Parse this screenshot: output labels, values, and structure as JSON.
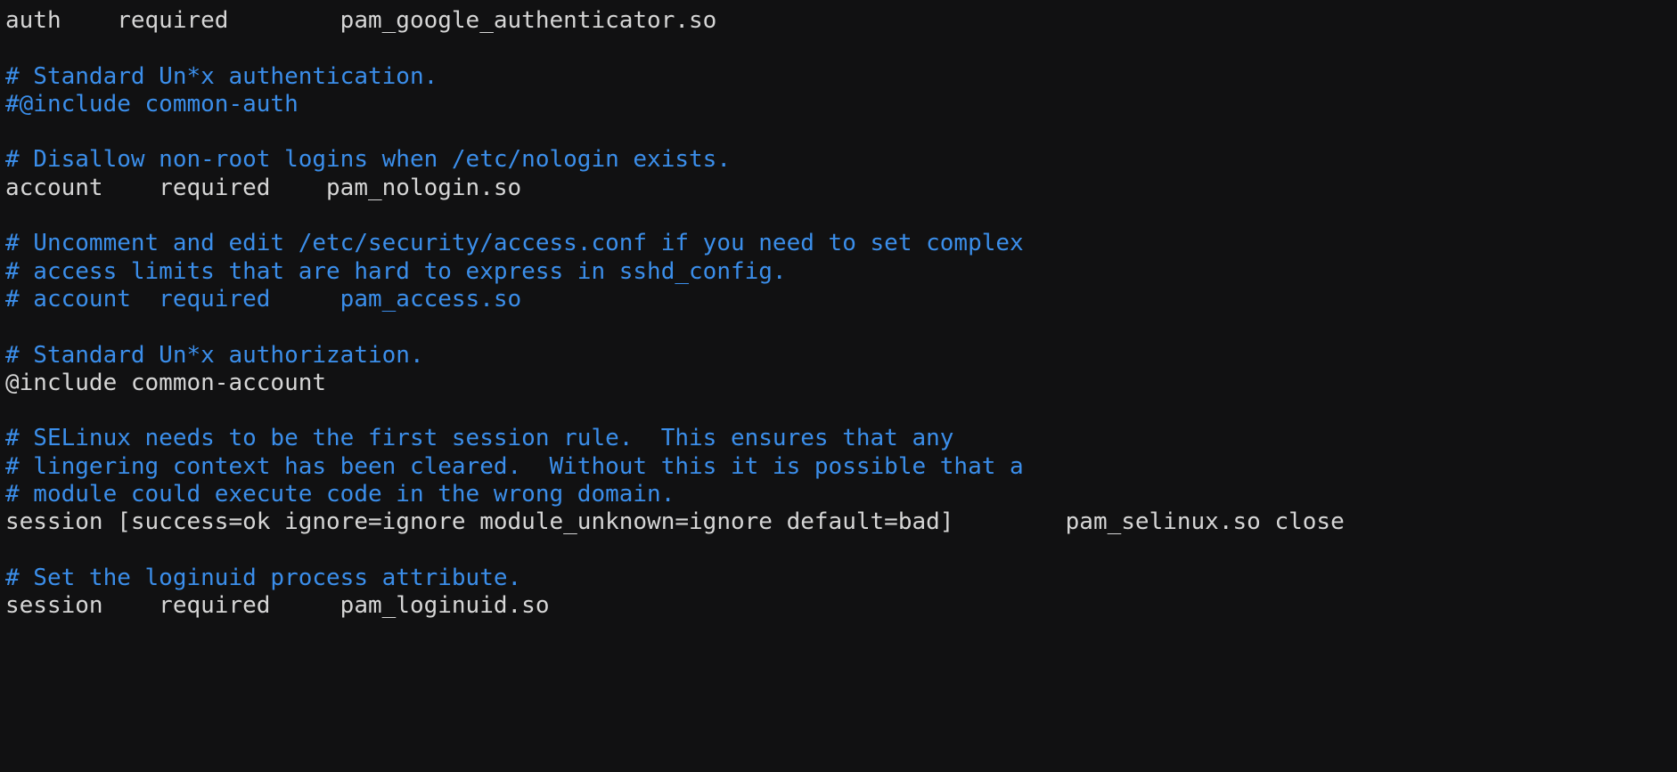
{
  "terminal": {
    "title": "pam.d sshd configuration",
    "background_color": "#111112",
    "default_text_color": "#d6d6d6",
    "comment_text_color": "#3b8eea",
    "font_size_px": 26,
    "columns_visible": 118,
    "lines": [
      {
        "text": "auth    required        pam_google_authenticator.so",
        "style": "default"
      },
      {
        "text": "",
        "style": "default"
      },
      {
        "text": "# Standard Un*x authentication.",
        "style": "comment"
      },
      {
        "text": "#@include common-auth",
        "style": "comment"
      },
      {
        "text": "",
        "style": "default"
      },
      {
        "text": "# Disallow non-root logins when /etc/nologin exists.",
        "style": "comment"
      },
      {
        "text": "account    required    pam_nologin.so",
        "style": "default"
      },
      {
        "text": "",
        "style": "default"
      },
      {
        "text": "# Uncomment and edit /etc/security/access.conf if you need to set complex",
        "style": "comment"
      },
      {
        "text": "# access limits that are hard to express in sshd_config.",
        "style": "comment"
      },
      {
        "text": "# account  required     pam_access.so",
        "style": "comment"
      },
      {
        "text": "",
        "style": "default"
      },
      {
        "text": "# Standard Un*x authorization.",
        "style": "comment"
      },
      {
        "text": "@include common-account",
        "style": "default"
      },
      {
        "text": "",
        "style": "default"
      },
      {
        "text": "# SELinux needs to be the first session rule.  This ensures that any",
        "style": "comment"
      },
      {
        "text": "# lingering context has been cleared.  Without this it is possible that a",
        "style": "comment"
      },
      {
        "text": "# module could execute code in the wrong domain.",
        "style": "comment"
      },
      {
        "text": "session [success=ok ignore=ignore module_unknown=ignore default=bad]        pam_selinux.so close",
        "style": "default"
      },
      {
        "text": "",
        "style": "default"
      },
      {
        "text": "# Set the loginuid process attribute.",
        "style": "comment"
      },
      {
        "text": "session    required     pam_loginuid.so",
        "style": "default"
      }
    ]
  }
}
